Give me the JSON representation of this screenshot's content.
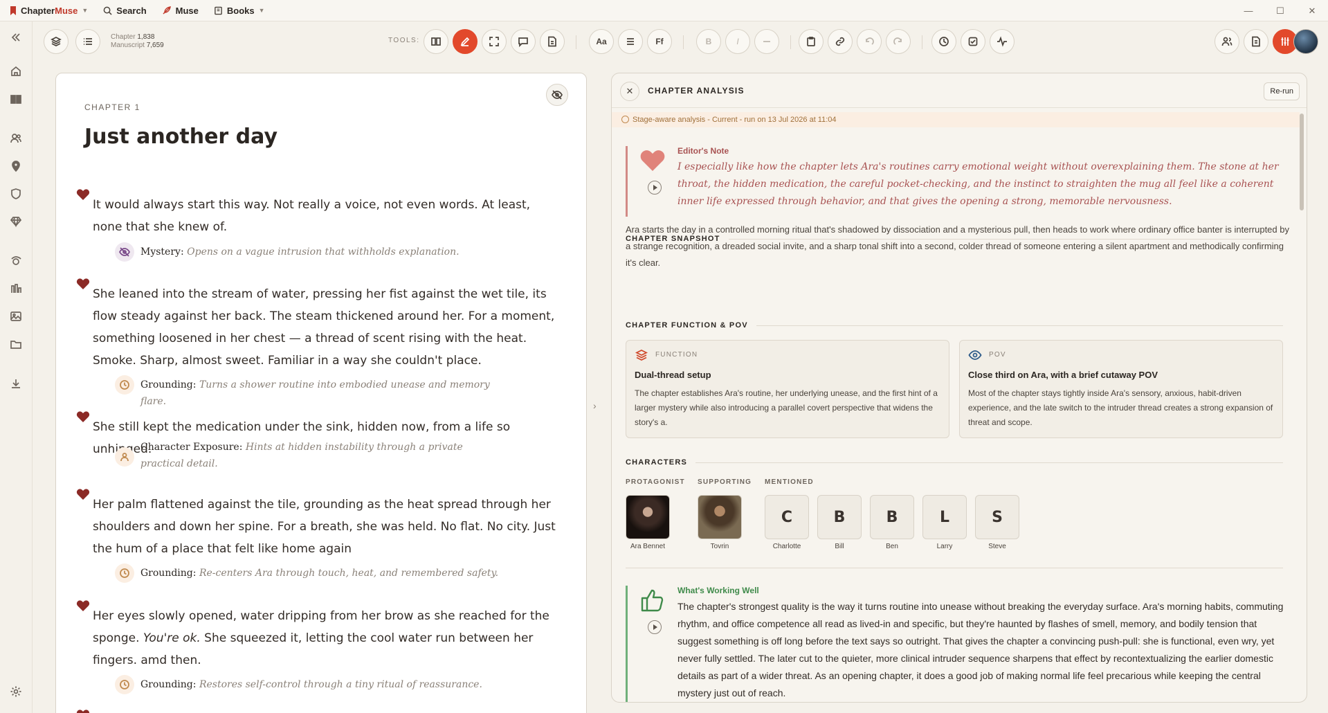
{
  "titlebar": {
    "brand_name": "Chapter",
    "brand_muse": "Muse",
    "search": "Search",
    "muse": "Muse",
    "books": "Books"
  },
  "toolbar": {
    "chapter_label": "Chapter",
    "chapter_count": "1,838",
    "manuscript_label": "Manuscript",
    "manuscript_count": "7,659",
    "tools_label": "TOOLS:",
    "font_btn": "Aa",
    "ff_btn": "Ff",
    "bold_btn": "B",
    "italic_btn": "I"
  },
  "editor": {
    "chapter_label": "CHAPTER 1",
    "title": "Just another day",
    "paragraphs": [
      {
        "text": "It would always start this way. Not really a voice, not even words. At least, none that she knew of.",
        "note_label": "Mystery:",
        "note_text": "Opens on a vague intrusion that withholds explanation."
      },
      {
        "text": "She leaned into the stream of water, pressing her fist against the wet tile, its flow steady against her back. The steam thickened around her. For a moment, something loosened in her chest — a thread of scent rising with the heat. Smoke. Sharp, almost sweet. Familiar in a way she couldn't place.",
        "note_label": "Grounding:",
        "note_text": "Turns a shower routine into embodied unease and memory flare."
      },
      {
        "text": "She still kept the medication under the sink, hidden now, from a life so unhinged.",
        "note_label": "Character Exposure:",
        "note_text": "Hints at hidden instability through a private practical detail."
      },
      {
        "text": "Her palm flattened against the tile, grounding as the heat spread through her shoulders and down her spine. For a breath, she was held. No flat. No city. Just the hum of a place that felt like home again",
        "note_label": "Grounding:",
        "note_text": "Re-centers Ara through touch, heat, and remembered safety."
      },
      {
        "text_before": "Her eyes slowly opened, water dripping from her brow as she reached for the sponge.",
        "text_italic": "You're ok.",
        "text_after": "She squeezed it, letting the cool water run between her fingers. amd then.",
        "note_label": "Grounding:",
        "note_text": "Restores self-control through a tiny ritual of reassurance."
      }
    ]
  },
  "analysis": {
    "title": "CHAPTER ANALYSIS",
    "rerun": "Re-run",
    "stage_text": "Stage-aware analysis - Current - run on 13 Jul 2026 at 11:04",
    "editors_note": {
      "title": "Editor's Note",
      "text": "I especially like how the chapter lets Ara's routines carry emotional weight without overexplaining them. The stone at her throat, the hidden medication, the careful pocket-checking, and the instinct to straighten the mug all feel like a coherent inner life expressed through behavior, and that gives the opening a strong, memorable nervousness."
    },
    "snapshot": {
      "heading": "CHAPTER SNAPSHOT",
      "text": "Ara starts the day in a controlled morning ritual that's shadowed by dissociation and a mysterious pull, then heads to work where ordinary office banter is interrupted by a strange recognition, a dreaded social invite, and a sharp tonal shift into a second, colder thread of someone entering a silent apartment and methodically confirming it's clear."
    },
    "function_pov": {
      "heading": "CHAPTER FUNCTION & POV",
      "function": {
        "label": "FUNCTION",
        "title": "Dual-thread setup",
        "text": "The chapter establishes Ara's routine, her underlying unease, and the first hint of a larger mystery while also introducing a parallel covert perspective that widens the story's a."
      },
      "pov": {
        "label": "POV",
        "title": "Close third on Ara, with a brief cutaway POV",
        "text": "Most of the chapter stays tightly inside Ara's sensory, anxious, habit-driven experience, and the late switch to the intruder thread creates a strong expansion of threat and scope."
      }
    },
    "characters": {
      "heading": "CHARACTERS",
      "protagonist_label": "PROTAGONIST",
      "supporting_label": "SUPPORTING",
      "mentioned_label": "MENTIONED",
      "protagonist": "Ara Bennet",
      "supporting": "Tovrin",
      "mentioned": [
        {
          "initial": "C",
          "name": "Charlotte"
        },
        {
          "initial": "B",
          "name": "Bill"
        },
        {
          "initial": "B",
          "name": "Ben"
        },
        {
          "initial": "L",
          "name": "Larry"
        },
        {
          "initial": "S",
          "name": "Steve"
        }
      ]
    },
    "working_well": {
      "title": "What's Working Well",
      "text": "The chapter's strongest quality is the way it turns routine into unease without breaking the everyday surface. Ara's morning habits, commuting rhythm, and office competence all read as lived-in and specific, but they're haunted by flashes of smell, memory, and bodily tension that suggest something is off long before the text says so outright. That gives the chapter a convincing push-pull: she is functional, even wry, yet never fully settled. The later cut to the quieter, more clinical intruder sequence sharpens that effect by recontextualizing the earlier domestic details as part of a wider threat. As an opening chapter, it does a good job of making normal life feel precarious while keeping the central mystery just out of reach."
    }
  },
  "colors": {
    "accent": "#e2492b",
    "heart": "#8b2a26",
    "editor_note": "#a85252",
    "working_well": "#3f8a4a"
  }
}
